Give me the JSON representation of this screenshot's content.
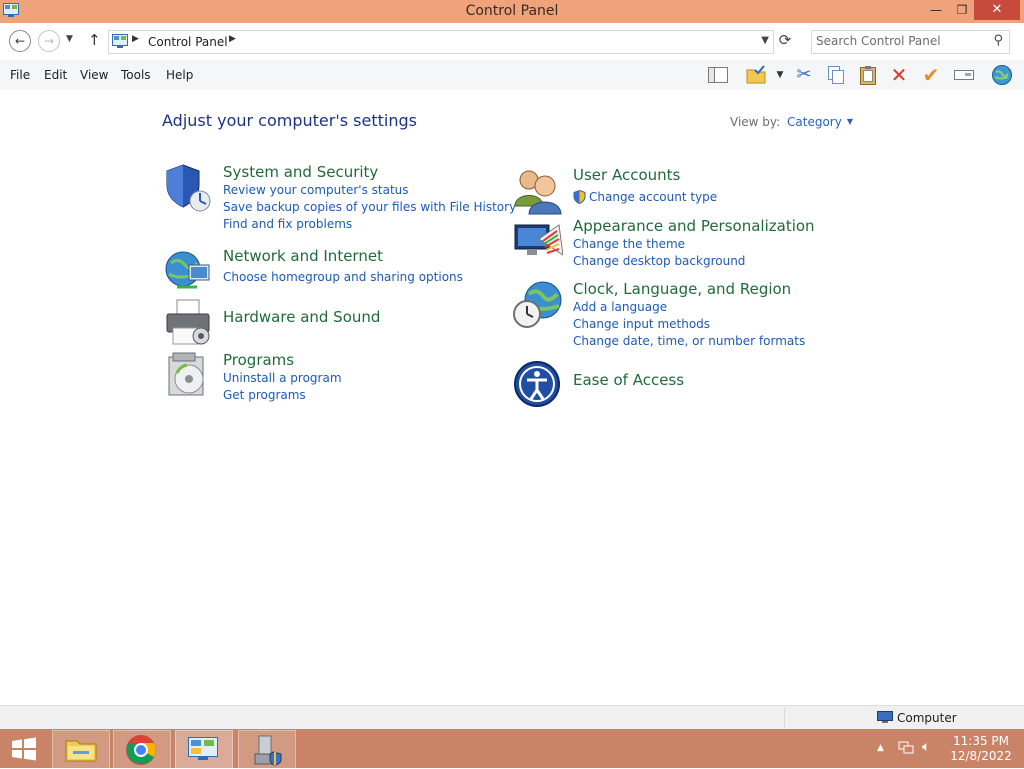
{
  "window": {
    "title": "Control Panel",
    "controls": {
      "minimize": "—",
      "maximize": "❐",
      "close": "✕"
    }
  },
  "address": {
    "breadcrumb": "Control Panel",
    "search_placeholder": "Search Control Panel"
  },
  "menu": {
    "items": [
      "File",
      "Edit",
      "View",
      "Tools",
      "Help"
    ]
  },
  "toolbar": {
    "icons": [
      "layout-icon",
      "folder-check-icon",
      "dropdown-arrow-icon",
      "cut-icon",
      "copy-icon",
      "paste-icon",
      "delete-icon",
      "checkmark-icon",
      "rename-icon",
      "globe-icon"
    ]
  },
  "main": {
    "heading": "Adjust your computer's settings",
    "view_by_label": "View by:",
    "view_by_value": "Category",
    "categories_left": [
      {
        "title": "System and Security",
        "icon": "shield-icon",
        "links": [
          "Review your computer's status",
          "Save backup copies of your files with File History",
          "Find and fix problems"
        ]
      },
      {
        "title": "Network and Internet",
        "icon": "network-globe-icon",
        "links": [
          "Choose homegroup and sharing options"
        ]
      },
      {
        "title": "Hardware and Sound",
        "icon": "printer-icon",
        "links": []
      },
      {
        "title": "Programs",
        "icon": "programs-disc-icon",
        "links": [
          "Uninstall a program",
          "Get programs"
        ]
      }
    ],
    "categories_right": [
      {
        "title": "User Accounts",
        "icon": "users-icon",
        "links": [
          "Change account type"
        ]
      },
      {
        "title": "Appearance and Personalization",
        "icon": "monitor-palette-icon",
        "links": [
          "Change the theme",
          "Change desktop background"
        ]
      },
      {
        "title": "Clock, Language, and Region",
        "icon": "clock-globe-icon",
        "links": [
          "Add a language",
          "Change input methods",
          "Change date, time, or number formats"
        ]
      },
      {
        "title": "Ease of Access",
        "icon": "ease-of-access-icon",
        "links": []
      }
    ]
  },
  "statusbar": {
    "location": "Computer"
  },
  "taskbar": {
    "apps": [
      "file-explorer-icon",
      "chrome-icon",
      "control-panel-icon",
      "remote-tool-icon"
    ],
    "time": "11:35 PM",
    "date": "12/8/2022"
  },
  "colors": {
    "titlebar": "#f0a27a",
    "taskbar": "#c98467",
    "category_title": "#1f6b3a",
    "link": "#1d5bb5",
    "heading": "#1e3287"
  }
}
